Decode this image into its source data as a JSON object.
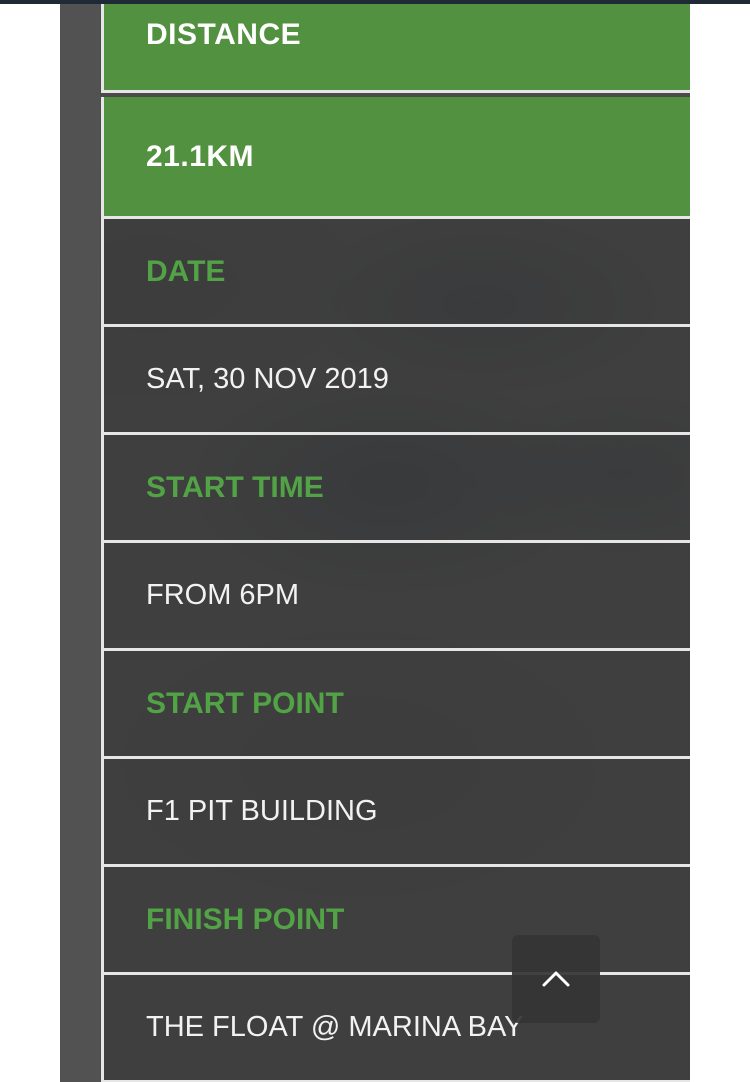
{
  "distance": {
    "label": "DISTANCE",
    "value": "21.1KM"
  },
  "details": [
    {
      "label": "DATE",
      "value": "SAT, 30 NOV 2019"
    },
    {
      "label": "START TIME",
      "value": "FROM 6PM"
    },
    {
      "label": "START POINT",
      "value": "F1 PIT BUILDING"
    },
    {
      "label": "FINISH POINT",
      "value": "THE FLOAT @ MARINA BAY"
    }
  ],
  "scroll_top": {
    "icon": "chevron-up-icon"
  },
  "colors": {
    "accent_green": "#52913f",
    "label_green": "#52a246",
    "panel_dark": "#4a4a4a",
    "divider": "#e6e6e6"
  }
}
